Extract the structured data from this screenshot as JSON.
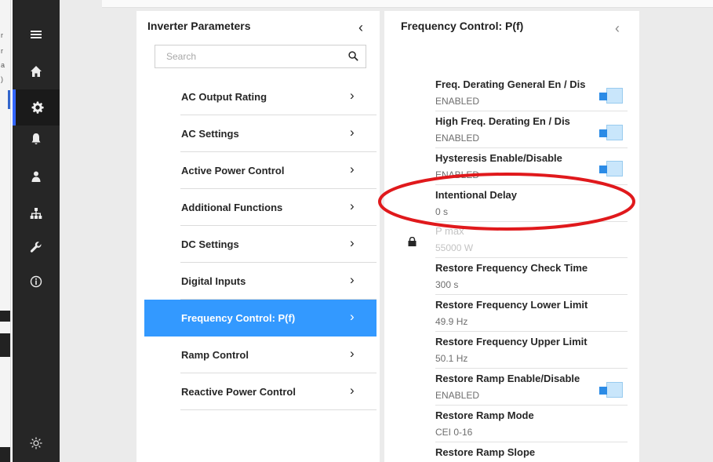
{
  "left_edge_fragments": [
    "r",
    "a",
    ")"
  ],
  "rail": {
    "items": [
      {
        "name": "menu-icon"
      },
      {
        "name": "home-icon"
      },
      {
        "name": "gear-icon"
      },
      {
        "name": "bell-icon"
      },
      {
        "name": "user-icon"
      },
      {
        "name": "network-icon"
      },
      {
        "name": "wrench-icon"
      },
      {
        "name": "info-icon"
      },
      {
        "name": "brightness-icon"
      }
    ],
    "active": "gear-icon"
  },
  "panel1": {
    "title": "Inverter Parameters",
    "search": {
      "placeholder": "Search",
      "value": ""
    },
    "items": [
      {
        "label": "AC Output Rating"
      },
      {
        "label": "AC Settings"
      },
      {
        "label": "Active Power Control"
      },
      {
        "label": "Additional Functions"
      },
      {
        "label": "DC Settings"
      },
      {
        "label": "Digital Inputs"
      },
      {
        "label": "Frequency Control: P(f)"
      },
      {
        "label": "Ramp Control"
      },
      {
        "label": "Reactive Power Control"
      }
    ],
    "selected": "Frequency Control: P(f)"
  },
  "panel2": {
    "title": "Frequency Control: P(f)",
    "params": [
      {
        "label": "Freq. Derating General En / Dis",
        "value": "ENABLED",
        "toggle": true,
        "toggle_on": true
      },
      {
        "label": "High Freq. Derating En / Dis",
        "value": "ENABLED",
        "toggle": true,
        "toggle_on": true
      },
      {
        "label": "Hysteresis Enable/Disable",
        "value": "ENABLED",
        "toggle": true,
        "toggle_on": true
      },
      {
        "label": "Intentional Delay",
        "value": "0 s"
      },
      {
        "label": "P max",
        "value": "55000 W",
        "locked": true
      },
      {
        "label": "Restore Frequency Check Time",
        "value": "300 s"
      },
      {
        "label": "Restore Frequency Lower Limit",
        "value": "49.9 Hz"
      },
      {
        "label": "Restore Frequency Upper Limit",
        "value": "50.1 Hz"
      },
      {
        "label": "Restore Ramp Enable/Disable",
        "value": "ENABLED",
        "toggle": true,
        "toggle_on": true
      },
      {
        "label": "Restore Ramp Mode",
        "value": "CEI 0-16"
      },
      {
        "label": "Restore Ramp Slope",
        "value": ""
      }
    ]
  },
  "colors": {
    "rail_bg": "#262626",
    "accent": "#3399ff",
    "toggle_knob": "#2b8be6",
    "annotation": "#e0191c"
  }
}
